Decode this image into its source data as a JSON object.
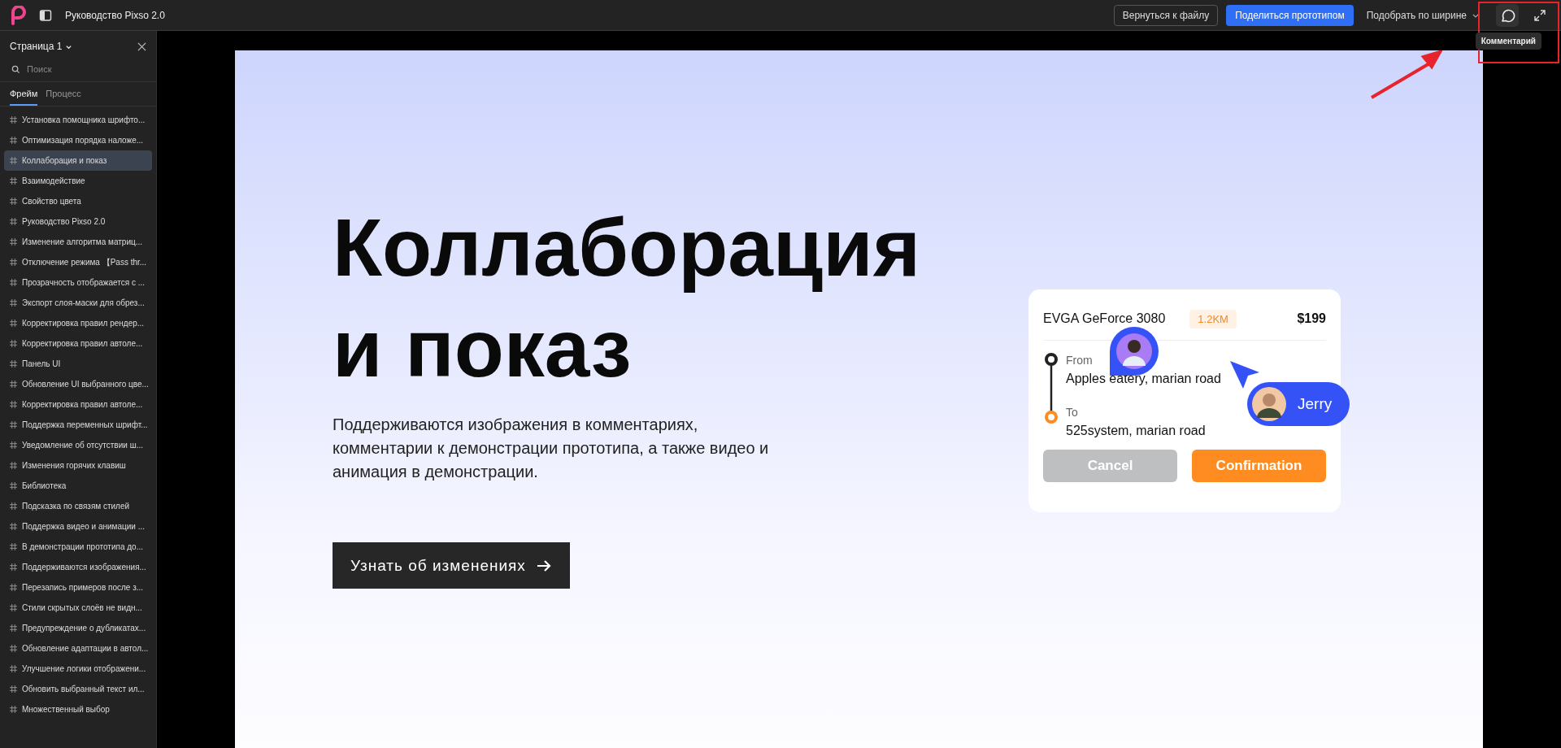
{
  "window": {
    "title": "Руководство Pixso 2.0"
  },
  "toolbar": {
    "back_button": "Вернуться к файлу",
    "share_button": "Поделиться прототипом",
    "zoom_select": "Подобрать по ширине",
    "tooltip": "Комментарий"
  },
  "sidebar": {
    "page_select": "Страница 1",
    "search": {
      "placeholder": "Поиск"
    },
    "tabs": [
      {
        "label": "Фрейм",
        "selected": true
      },
      {
        "label": "Процесс",
        "selected": false
      }
    ],
    "items": [
      {
        "label": "Установка помощника шрифто...",
        "selected": false
      },
      {
        "label": "Оптимизация порядка наложе...",
        "selected": false
      },
      {
        "label": "Коллаборация и показ",
        "selected": true
      },
      {
        "label": "Взаимодействие",
        "selected": false
      },
      {
        "label": "Свойство цвета",
        "selected": false
      },
      {
        "label": "Руководство Pixso 2.0",
        "selected": false
      },
      {
        "label": "Изменение алгоритма матриц...",
        "selected": false
      },
      {
        "label": "Отключение режима 【Pass thr...",
        "selected": false
      },
      {
        "label": "Прозрачность отображается с ...",
        "selected": false
      },
      {
        "label": "Экспорт слоя-маски для обрез...",
        "selected": false
      },
      {
        "label": "Корректировка правил рендер...",
        "selected": false
      },
      {
        "label": "Корректировка правил автоле...",
        "selected": false
      },
      {
        "label": "Панель UI",
        "selected": false
      },
      {
        "label": "Обновление UI выбранного цве...",
        "selected": false
      },
      {
        "label": "Корректировка правил автоле...",
        "selected": false
      },
      {
        "label": "Поддержка переменных шрифт...",
        "selected": false
      },
      {
        "label": "Уведомление об отсутствии ш...",
        "selected": false
      },
      {
        "label": "Изменения горячих клавиш",
        "selected": false
      },
      {
        "label": "Библиотека",
        "selected": false
      },
      {
        "label": "Подсказка по связям стилей",
        "selected": false
      },
      {
        "label": "Поддержка видео и анимации ...",
        "selected": false
      },
      {
        "label": "В демонстрации прототипа до...",
        "selected": false
      },
      {
        "label": "Поддерживаются изображения...",
        "selected": false
      },
      {
        "label": "Перезапись примеров после з...",
        "selected": false
      },
      {
        "label": "Стили скрытых слоёв не видн...",
        "selected": false
      },
      {
        "label": "Предупреждение о дубликатах...",
        "selected": false
      },
      {
        "label": "Обновление адаптации в автол...",
        "selected": false
      },
      {
        "label": "Улучшение логики отображени...",
        "selected": false
      },
      {
        "label": "Обновить выбранный текст ил...",
        "selected": false
      },
      {
        "label": "Множественный выбор",
        "selected": false
      }
    ]
  },
  "frame": {
    "heading": "Коллаборация и показ",
    "paragraph": "Поддерживаются изображения в комментариях, комментарии к демонстрации прототипа, а также видео и анимация в демонстрации.",
    "cta_button": "Узнать об изменениях",
    "card": {
      "title": "EVGA GeForce 3080",
      "distance": "1.2KM",
      "price": "$199",
      "from_label": "From",
      "from_address": "Apples eatery, marian road",
      "to_label": "To",
      "to_address": "525system, marian road",
      "cancel_button": "Cancel",
      "confirm_button": "Confirmation",
      "cursor_name": "Jerry"
    }
  }
}
